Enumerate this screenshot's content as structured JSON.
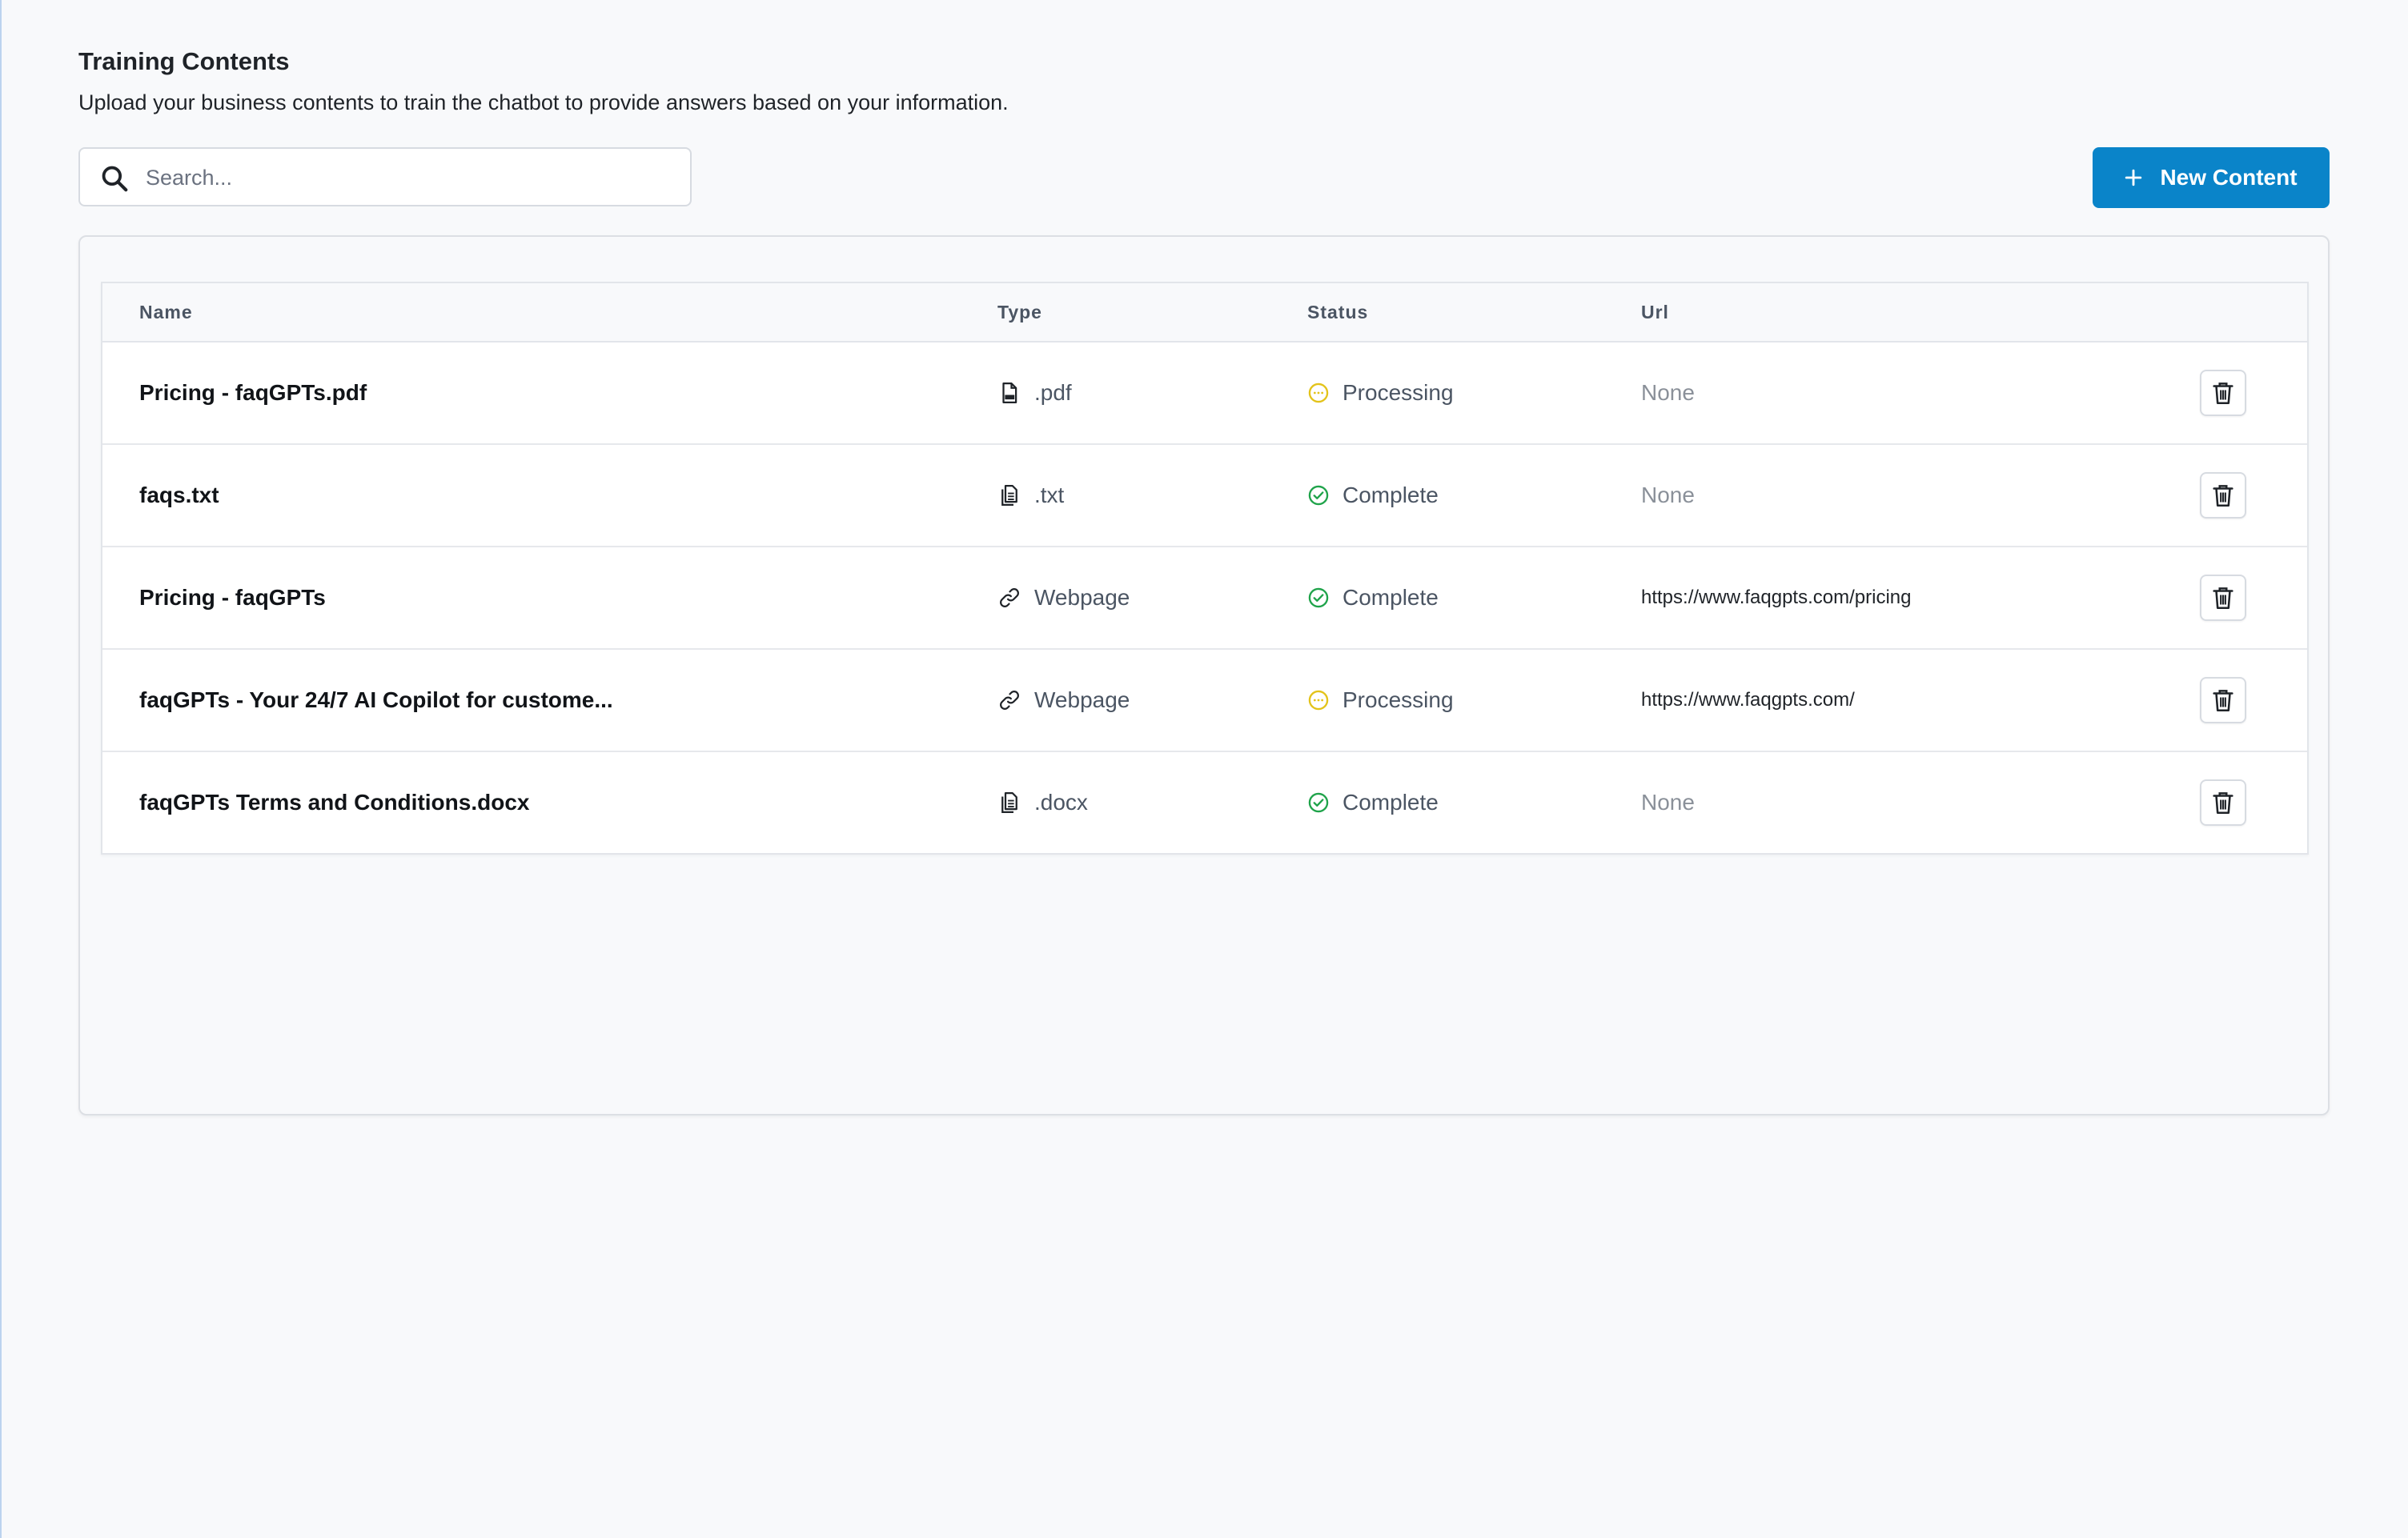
{
  "header": {
    "title": "Training Contents",
    "subtitle": "Upload your business contents to train the chatbot to provide answers based on your information."
  },
  "search": {
    "placeholder": "Search...",
    "value": "",
    "icon": "search-icon"
  },
  "new_button": {
    "label": "New Content",
    "icon": "plus-icon",
    "color": "#0a84c9"
  },
  "table": {
    "columns": [
      "Name",
      "Type",
      "Status",
      "Url"
    ],
    "rows": [
      {
        "name": "Pricing - faqGPTs.pdf",
        "type": ".pdf",
        "type_icon": "pdf-file-icon",
        "status": "Processing",
        "status_icon": "processing-icon",
        "url": "None"
      },
      {
        "name": "faqs.txt",
        "type": ".txt",
        "type_icon": "document-file-icon",
        "status": "Complete",
        "status_icon": "check-circle-icon",
        "url": "None"
      },
      {
        "name": "Pricing - faqGPTs",
        "type": "Webpage",
        "type_icon": "link-icon",
        "status": "Complete",
        "status_icon": "check-circle-icon",
        "url": "https://www.faqgpts.com/pricing"
      },
      {
        "name": "faqGPTs - Your 24/7 AI Copilot for custome...",
        "type": "Webpage",
        "type_icon": "link-icon",
        "status": "Processing",
        "status_icon": "processing-icon",
        "url": "https://www.faqgpts.com/"
      },
      {
        "name": "faqGPTs Terms and Conditions.docx",
        "type": ".docx",
        "type_icon": "document-file-icon",
        "status": "Complete",
        "status_icon": "check-circle-icon",
        "url": "None"
      }
    ]
  },
  "colors": {
    "processing": "#e3c31a",
    "complete": "#1fa34a",
    "accent": "#0a84c9"
  }
}
